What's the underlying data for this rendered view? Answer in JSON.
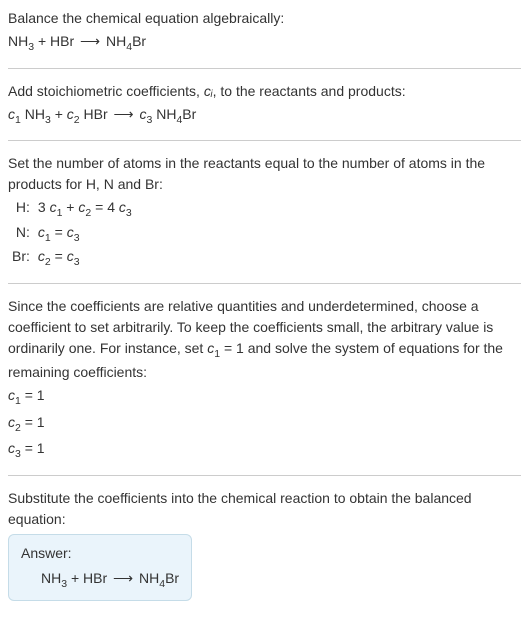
{
  "section1": {
    "title": "Balance the chemical equation algebraically:",
    "equation": "NH₃ + HBr ⟶ NH₄Br"
  },
  "section2": {
    "title_part1": "Add stoichiometric coefficients, ",
    "title_var": "cᵢ",
    "title_part2": ", to the reactants and products:",
    "equation": "c₁ NH₃ + c₂ HBr ⟶ c₃ NH₄Br"
  },
  "section3": {
    "title": "Set the number of atoms in the reactants equal to the number of atoms in the products for H, N and Br:",
    "rows": [
      {
        "label": "H:",
        "eq": "3 c₁ + c₂ = 4 c₃"
      },
      {
        "label": "N:",
        "eq": "c₁ = c₃"
      },
      {
        "label": "Br:",
        "eq": "c₂ = c₃"
      }
    ]
  },
  "section4": {
    "text": "Since the coefficients are relative quantities and underdetermined, choose a coefficient to set arbitrarily. To keep the coefficients small, the arbitrary value is ordinarily one. For instance, set c₁ = 1 and solve the system of equations for the remaining coefficients:",
    "solutions": [
      "c₁ = 1",
      "c₂ = 1",
      "c₃ = 1"
    ]
  },
  "section5": {
    "title": "Substitute the coefficients into the chemical reaction to obtain the balanced equation:",
    "answer_label": "Answer:",
    "answer_eq": "NH₃ + HBr ⟶ NH₄Br"
  }
}
